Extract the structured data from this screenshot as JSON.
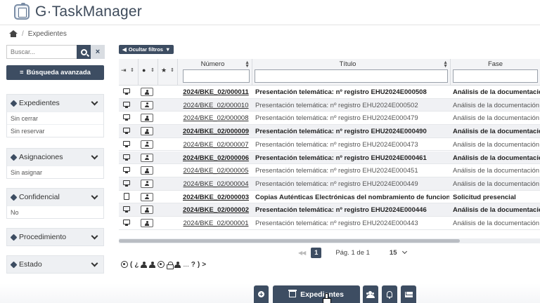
{
  "app": {
    "title": "G·TaskManager"
  },
  "breadcrumb": {
    "separator": "/",
    "current": "Expedientes"
  },
  "sidebar": {
    "search_placeholder": "Buscar...",
    "clear_label": "×",
    "advanced_search": "Búsqueda avanzada",
    "facets": [
      {
        "title": "Expedientes",
        "items": [
          "Sin cerrar",
          "Sin reservar"
        ]
      },
      {
        "title": "Asignaciones",
        "items": [
          "Sin asignar"
        ]
      },
      {
        "title": "Confidencial",
        "items": [
          "No"
        ]
      },
      {
        "title": "Procedimiento",
        "items": []
      },
      {
        "title": "Estado",
        "items": []
      }
    ]
  },
  "filters": {
    "toggle_label": "Ocultar filtros"
  },
  "table": {
    "columns": {
      "numero": "Número",
      "titulo": "Título",
      "fase": "Fase"
    },
    "rows": [
      {
        "device": "monitor",
        "numero": "2024/BKE_02/000011",
        "titulo": "Presentación telemática: nº registro EHU2024E000508",
        "fase": "Análisis de la documentación",
        "bold": true
      },
      {
        "device": "monitor",
        "numero": "2024/BKE_02/000010",
        "titulo": "Presentación telemática: nº registro EHU2024E000502",
        "fase": "Análisis de la documentación",
        "bold": false
      },
      {
        "device": "monitor",
        "numero": "2024/BKE_02/000008",
        "titulo": "Presentación telemática: nº registro EHU2024E000479",
        "fase": "Análisis de la documentación",
        "bold": false
      },
      {
        "device": "monitor",
        "numero": "2024/BKE_02/000009",
        "titulo": "Presentación telemática: nº registro EHU2024E000490",
        "fase": "Análisis de la documentación",
        "bold": true
      },
      {
        "device": "monitor",
        "numero": "2024/BKE_02/000007",
        "titulo": "Presentación telemática: nº registro EHU2024E000473",
        "fase": "Análisis de la documentación",
        "bold": false
      },
      {
        "device": "monitor",
        "numero": "2024/BKE_02/000006",
        "titulo": "Presentación telemática: nº registro EHU2024E000461",
        "fase": "Análisis de la documentación",
        "bold": true
      },
      {
        "device": "monitor",
        "numero": "2024/BKE_02/000005",
        "titulo": "Presentación telemática: nº registro EHU2024E000451",
        "fase": "Análisis de la documentación",
        "bold": false
      },
      {
        "device": "monitor",
        "numero": "2024/BKE_02/000004",
        "titulo": "Presentación telemática: nº registro EHU2024E000449",
        "fase": "Análisis de la documentación",
        "bold": false
      },
      {
        "device": "doc",
        "numero": "2024/BKE_02/000003",
        "titulo": "Copias Auténticas Electrónicas del nombramiento de funcionario",
        "fase": "Solicitud presencial",
        "bold": true
      },
      {
        "device": "monitor",
        "numero": "2024/BKE_02/000002",
        "titulo": "Presentación telemática: nº registro EHU2024E000446",
        "fase": "Análisis de la documentación",
        "bold": true
      },
      {
        "device": "monitor",
        "numero": "2024/BKE_02/000001",
        "titulo": "Presentación telemática: nº registro EHU2024E000443",
        "fase": "Análisis de la documentación",
        "bold": false
      }
    ]
  },
  "pager": {
    "current_page": "1",
    "page_info": "Pág. 1 de 1",
    "page_size": "15"
  },
  "legend": {
    "open": "(",
    "q_inv": "¿",
    "dots": "...",
    "q": "?",
    "close": ")",
    "chevron": ">"
  },
  "toolbar": {
    "main_label": "Expedientes"
  },
  "colors": {
    "primary": "#3d4d62",
    "header_bg": "#f3f4f6",
    "row_alt": "#f0f1f4"
  }
}
